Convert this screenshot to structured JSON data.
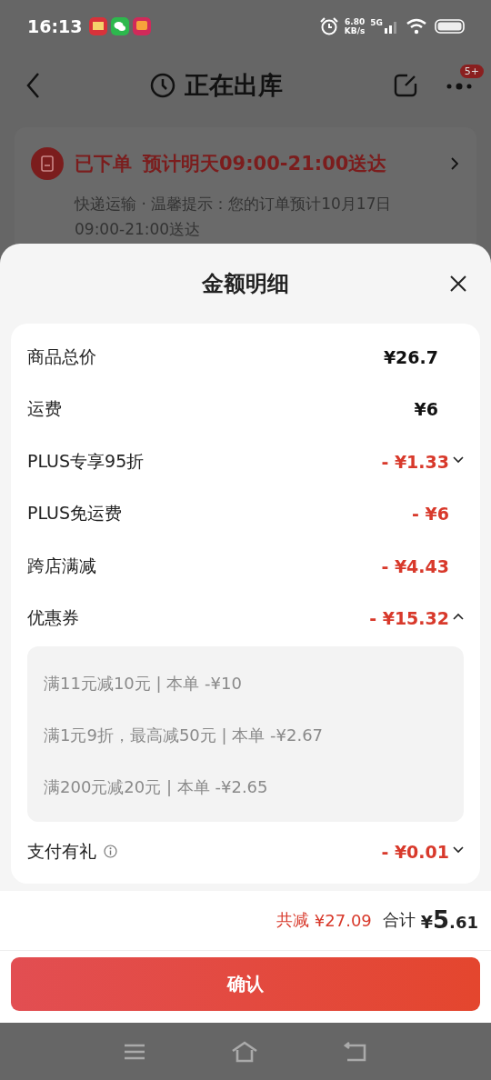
{
  "status_bar": {
    "time": "16:13",
    "net_speed": "6.80",
    "net_unit": "KB/s",
    "network": "5G"
  },
  "header": {
    "title": "正在出库",
    "badge": "5+"
  },
  "delivery": {
    "status": "已下单",
    "eta": "预计明天09:00-21:00送达",
    "note": "快递运输 · 温馨提示：您的订单预计10月17日",
    "note_cut": "09:00-21:00送达"
  },
  "sheet": {
    "title": "金额明细",
    "rows": [
      {
        "label": "商品总价",
        "amount": "¥26.7",
        "kind": "plain"
      },
      {
        "label": "运费",
        "amount": "¥6",
        "kind": "plain"
      },
      {
        "label": "PLUS专享95折",
        "amount": "- ¥1.33",
        "kind": "discount",
        "expanded": false
      },
      {
        "label": "PLUS免运费",
        "amount": "- ¥6",
        "kind": "discount"
      },
      {
        "label": "跨店满减",
        "amount": "- ¥4.43",
        "kind": "discount"
      },
      {
        "label": "优惠券",
        "amount": "- ¥15.32",
        "kind": "discount",
        "expanded": true,
        "details": [
          "满11元减10元 | 本单 -¥10",
          "满1元9折，最高减50元 | 本单 -¥2.67",
          "满200元减20元 | 本单 -¥2.65"
        ]
      },
      {
        "label": "支付有礼",
        "amount": "- ¥0.01",
        "kind": "discount",
        "info": true,
        "expanded": false
      }
    ],
    "savings_label": "共减",
    "savings": "¥27.09",
    "total_label": "合计",
    "total": {
      "currency": "¥",
      "integer": "5",
      "decimal": ".61"
    },
    "confirm": "确认"
  }
}
